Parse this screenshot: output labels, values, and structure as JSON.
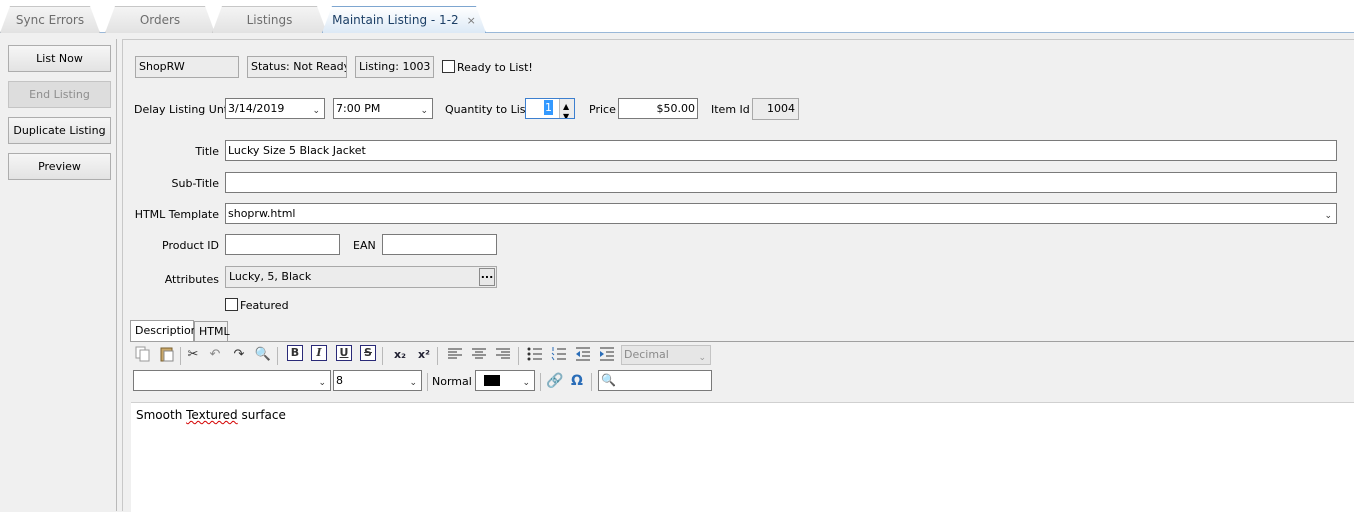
{
  "tabs": [
    {
      "label": "Sync Errors",
      "active": false
    },
    {
      "label": "Orders",
      "active": false
    },
    {
      "label": "Listings",
      "active": false
    },
    {
      "label": "Maintain Listing - 1-2",
      "active": true,
      "close": "×"
    }
  ],
  "sidebar": {
    "list_now": "List Now",
    "end_listing": "End Listing",
    "duplicate_listing": "Duplicate Listing",
    "preview": "Preview"
  },
  "header": {
    "store": "ShopRW",
    "status": "Status: Not Ready",
    "listing": "Listing: 1003",
    "ready_label": "Ready to List!",
    "ready_checked": false
  },
  "delay": {
    "label": "Delay Listing Until",
    "date": "3/14/2019",
    "time": "7:00 PM"
  },
  "quantity": {
    "label": "Quantity to List",
    "value": "1"
  },
  "price": {
    "label": "Price",
    "value": "$50.00"
  },
  "item_id": {
    "label": "Item Id",
    "value": "1004"
  },
  "fields": {
    "title_label": "Title",
    "title_value": "Lucky Size 5 Black Jacket",
    "subtitle_label": "Sub-Title",
    "subtitle_value": "",
    "template_label": "HTML Template",
    "template_value": "shoprw.html",
    "product_id_label": "Product ID",
    "product_id_value": "",
    "ean_label": "EAN",
    "ean_value": "",
    "attributes_label": "Attributes",
    "attributes_value": "Lucky, 5, Black",
    "attributes_button": "...",
    "featured_label": "Featured",
    "featured_checked": false
  },
  "editor": {
    "tabs": [
      "Description",
      "HTML"
    ],
    "list_style": "Decimal",
    "font_family": "",
    "font_size": "8",
    "paragraph_style": "Normal",
    "text_color": "#000000",
    "content_before": "Smooth ",
    "content_misspelled": "Textured",
    "content_after": " surface"
  },
  "icons": {
    "copy": "copy-icon",
    "paste": "paste-icon",
    "cut": "scissors-icon",
    "undo": "undo-icon",
    "redo": "redo-icon",
    "find": "magnifier-icon",
    "bold": "B",
    "italic": "I",
    "underline": "U",
    "strike": "S",
    "subscript": "x₂",
    "superscript": "x²",
    "omega": "Ω"
  }
}
